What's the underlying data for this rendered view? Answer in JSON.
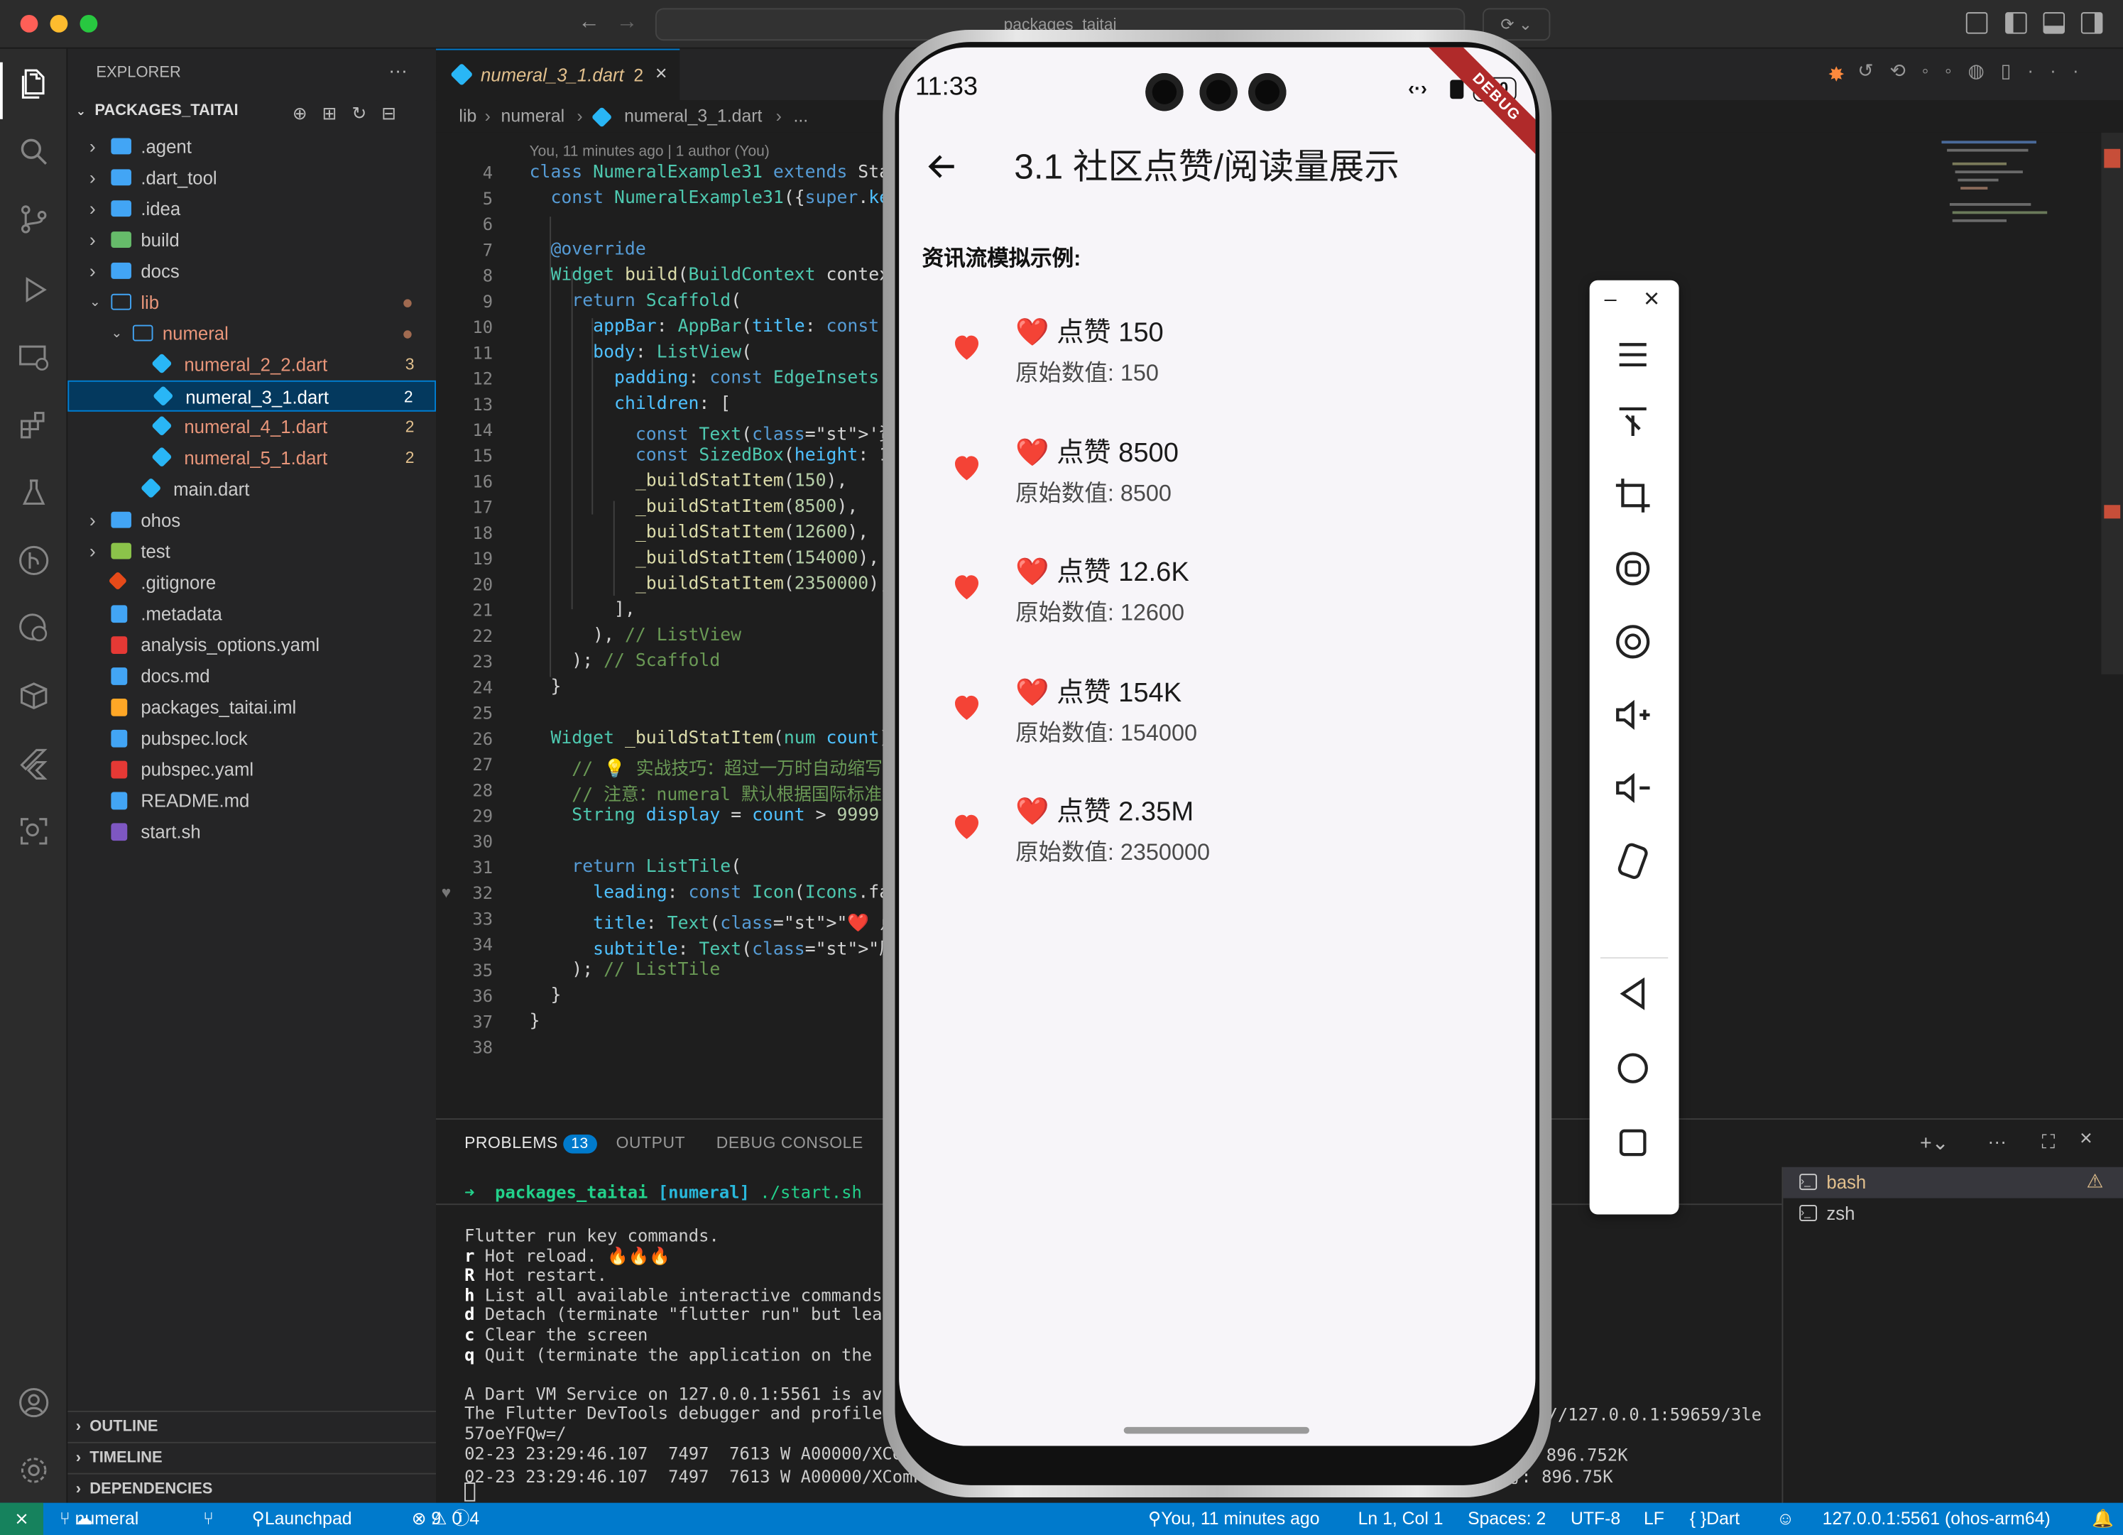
{
  "window": {
    "command_center": "packages_taitai"
  },
  "explorer": {
    "header": "EXPLORER",
    "project": "PACKAGES_TAITAI",
    "items": [
      {
        "label": ".agent"
      },
      {
        "label": ".dart_tool"
      },
      {
        "label": ".idea"
      },
      {
        "label": "build"
      },
      {
        "label": "docs"
      },
      {
        "label": "lib"
      },
      {
        "label": "numeral"
      },
      {
        "label": "numeral_2_2.dart",
        "badge": "3"
      },
      {
        "label": "numeral_3_1.dart",
        "badge": "2"
      },
      {
        "label": "numeral_4_1.dart",
        "badge": "2"
      },
      {
        "label": "numeral_5_1.dart",
        "badge": "2"
      },
      {
        "label": "main.dart"
      },
      {
        "label": "ohos"
      },
      {
        "label": "test"
      },
      {
        "label": ".gitignore"
      },
      {
        "label": ".metadata"
      },
      {
        "label": "analysis_options.yaml"
      },
      {
        "label": "docs.md"
      },
      {
        "label": "packages_taitai.iml"
      },
      {
        "label": "pubspec.lock"
      },
      {
        "label": "pubspec.yaml"
      },
      {
        "label": "README.md"
      },
      {
        "label": "start.sh"
      }
    ],
    "sections": [
      "OUTLINE",
      "TIMELINE",
      "DEPENDENCIES"
    ]
  },
  "editor": {
    "tab": {
      "name": "numeral_3_1.dart",
      "count": "2"
    },
    "breadcrumb": [
      "lib",
      "numeral",
      "numeral_3_1.dart",
      "..."
    ],
    "blame": "You, 11 minutes ago | 1 author (You)",
    "lines": [
      {
        "n": "4",
        "t": "class NumeralExample31 extends Sta"
      },
      {
        "n": "5",
        "t": "  const NumeralExample31({super.key"
      },
      {
        "n": "6",
        "t": ""
      },
      {
        "n": "7",
        "t": "  @override"
      },
      {
        "n": "8",
        "t": "  Widget build(BuildContext contex"
      },
      {
        "n": "9",
        "t": "    return Scaffold("
      },
      {
        "n": "10",
        "t": "      appBar: AppBar(title: const "
      },
      {
        "n": "11",
        "t": "      body: ListView("
      },
      {
        "n": "12",
        "t": "        padding: const EdgeInsets.a"
      },
      {
        "n": "13",
        "t": "        children: ["
      },
      {
        "n": "14",
        "t": "          const Text('资讯流模拟示例:"
      },
      {
        "n": "15",
        "t": "          const SizedBox(height: 1("
      },
      {
        "n": "16",
        "t": "          _buildStatItem(150),"
      },
      {
        "n": "17",
        "t": "          _buildStatItem(8500),"
      },
      {
        "n": "18",
        "t": "          _buildStatItem(12600),"
      },
      {
        "n": "19",
        "t": "          _buildStatItem(154000),"
      },
      {
        "n": "20",
        "t": "          _buildStatItem(2350000),"
      },
      {
        "n": "21",
        "t": "        ],"
      },
      {
        "n": "22",
        "t": "      ), // ListView"
      },
      {
        "n": "23",
        "t": "    ); // Scaffold"
      },
      {
        "n": "24",
        "t": "  }"
      },
      {
        "n": "25",
        "t": ""
      },
      {
        "n": "26",
        "t": "  Widget _buildStatItem(num count)"
      },
      {
        "n": "27",
        "t": "    // 💡 实战技巧：超过一万时自动缩写"
      },
      {
        "n": "28",
        "t": "    // 注意：numeral 默认根据国际标准缩"
      },
      {
        "n": "29",
        "t": "    String display = count > 9999 "
      },
      {
        "n": "30",
        "t": ""
      },
      {
        "n": "31",
        "t": "    return ListTile("
      },
      {
        "n": "32",
        "t": "      leading: const Icon(Icons.fav"
      },
      {
        "n": "33",
        "t": "      title: Text(\"❤️ 点赞 $display\""
      },
      {
        "n": "34",
        "t": "      subtitle: Text(\"原始数值: $cou"
      },
      {
        "n": "35",
        "t": "    ); // ListTile"
      },
      {
        "n": "36",
        "t": "  }"
      },
      {
        "n": "37",
        "t": "}"
      },
      {
        "n": "38",
        "t": ""
      }
    ]
  },
  "panel": {
    "tabs": {
      "problems": "PROBLEMS",
      "problems_count": "13",
      "output": "OUTPUT",
      "debug": "DEBUG CONSOLE"
    },
    "prompt": {
      "arrow": "➜",
      "dir": "packages_taitai",
      "branch": "[numeral]",
      "cmd": "./start.sh"
    },
    "lines": [
      "Flutter run key commands.",
      "r Hot reload. 🔥🔥🔥",
      "R Hot restart.",
      "h List all available interactive commands.",
      "d Detach (terminate \"flutter run\" but leav",
      "c Clear the screen",
      "q Quit (terminate the application on the d",
      "",
      "A Dart VM Service on 127.0.0.1:5561 is ava",
      "The Flutter DevTools debugger and profiler",
      "57oeYFQw=/",
      "02-23 23:29:46.107  7497  7613 W A00000/XComF",
      "02-23 23:29:46.107  7497  7613 W A00000/XComFlutterOHOS_Native: flutter settings log message: 📊 精确简写: 896.75K"
    ],
    "right_fragments": {
      "l1": "//127.0.0.1:59659/3le",
      "l2": ": 896.752K"
    },
    "terminals": [
      "bash",
      "zsh"
    ]
  },
  "phone": {
    "time": "11:33",
    "battery": "100",
    "debug_banner": "DEBUG",
    "app_title": "3.1 社区点赞/阅读量展示",
    "section_label": "资讯流模拟示例:",
    "items": [
      {
        "title": "❤️ 点赞 150",
        "subtitle": "原始数值: 150"
      },
      {
        "title": "❤️ 点赞 8500",
        "subtitle": "原始数值: 8500"
      },
      {
        "title": "❤️ 点赞 12.6K",
        "subtitle": "原始数值: 12600"
      },
      {
        "title": "❤️ 点赞 154K",
        "subtitle": "原始数值: 154000"
      },
      {
        "title": "❤️ 点赞 2.35M",
        "subtitle": "原始数值: 2350000"
      }
    ],
    "colors": {
      "heart": "#f44336"
    }
  },
  "status": {
    "branch": "numeral",
    "launchpad": "Launchpad",
    "errors": "9",
    "warnings": "0",
    "info": "4",
    "blame": "You, 11 minutes ago",
    "position": "Ln 1, Col 1",
    "spaces": "Spaces: 2",
    "encoding": "UTF-8",
    "eol": "LF",
    "language": "Dart",
    "device": "127.0.0.1:5561 (ohos-arm64)"
  }
}
